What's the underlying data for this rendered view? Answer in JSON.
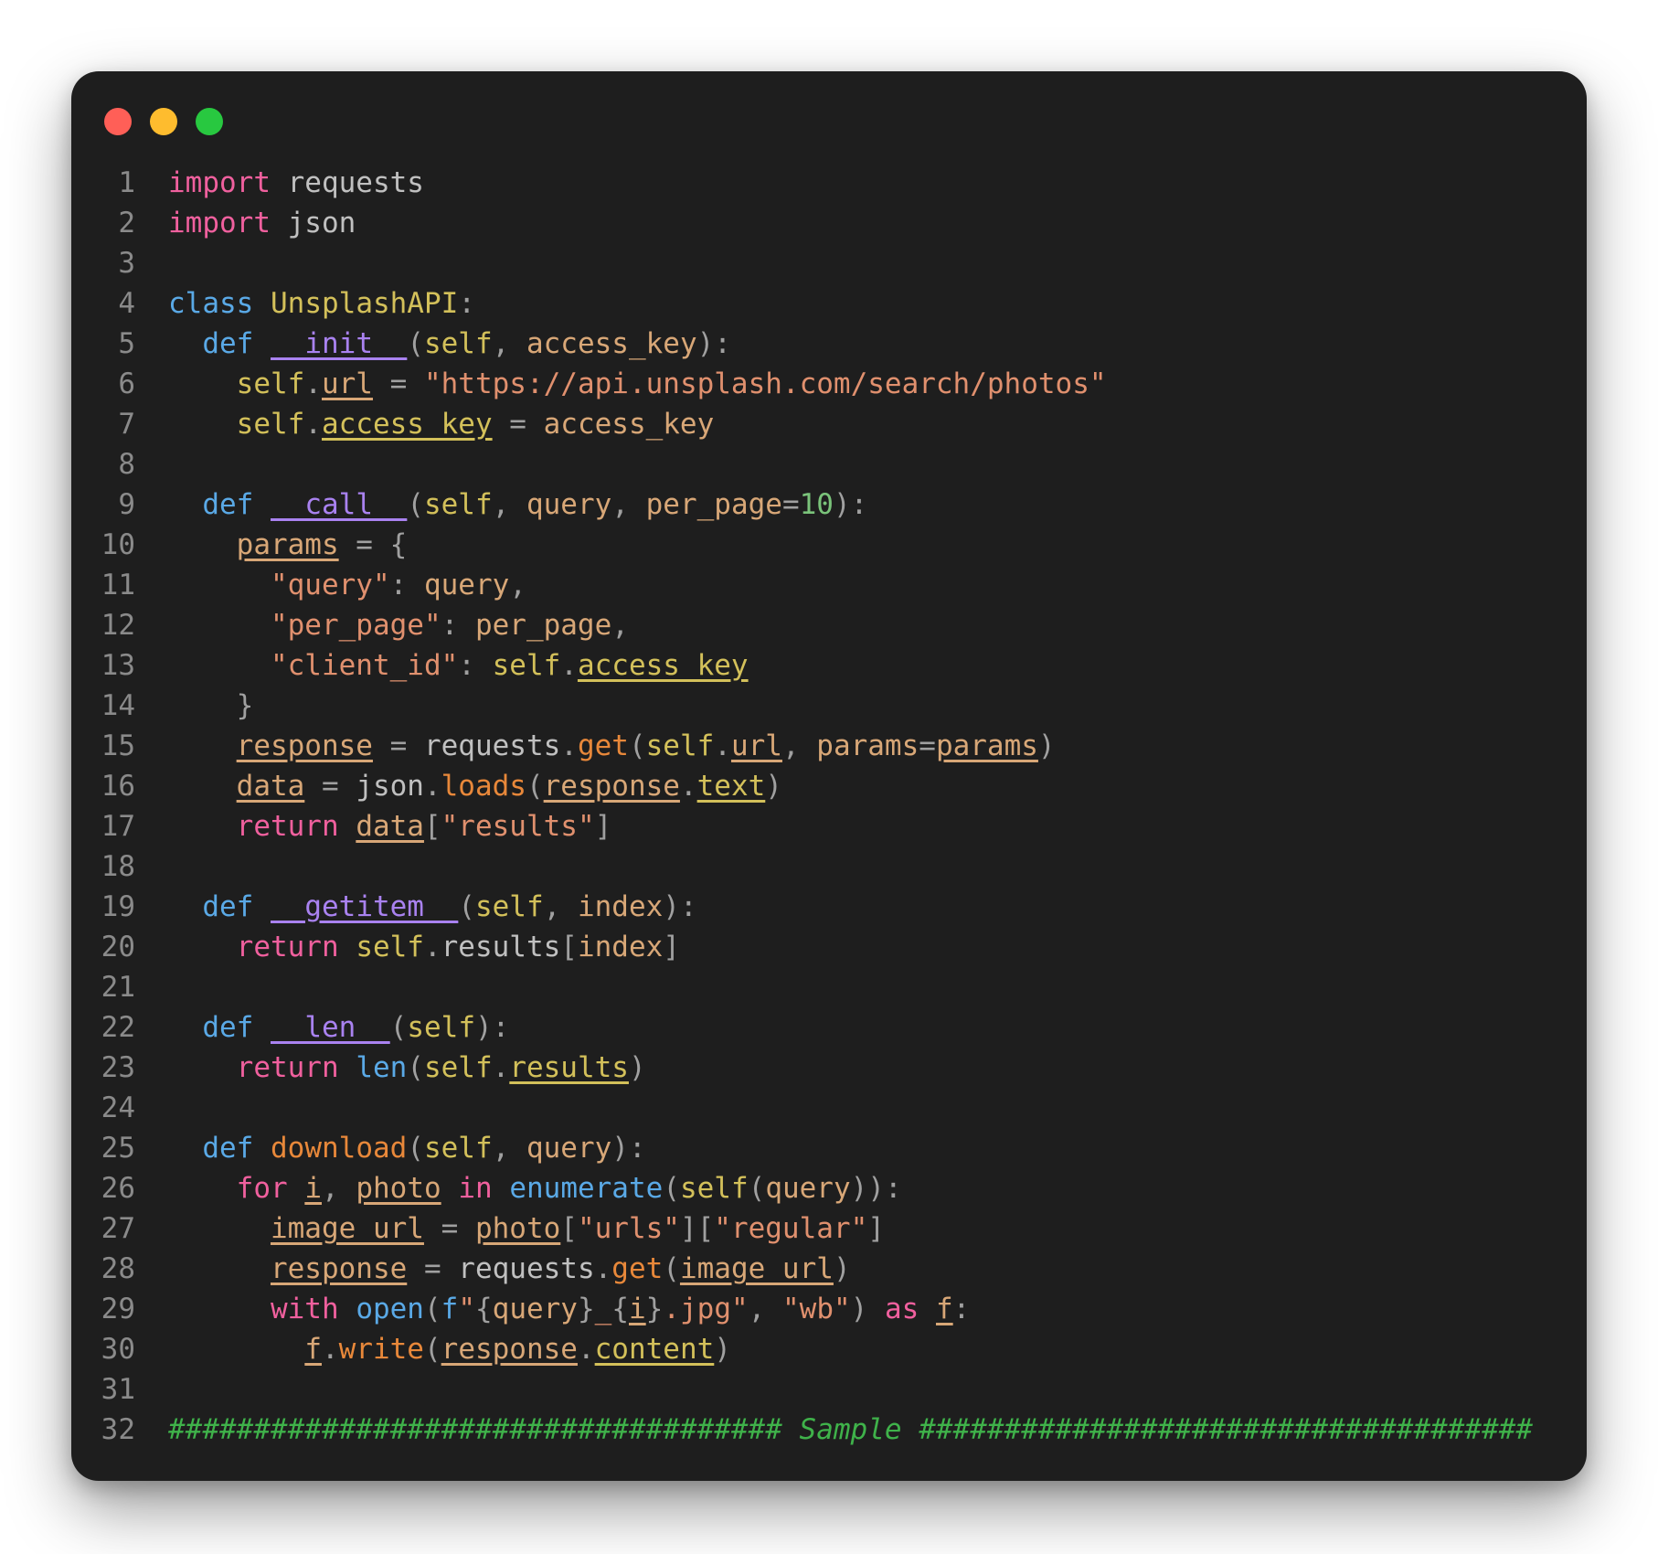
{
  "window": {
    "controls": [
      {
        "name": "close-button",
        "color": "#ff5f57"
      },
      {
        "name": "minimize-button",
        "color": "#febc2e"
      },
      {
        "name": "maximize-button",
        "color": "#28c840"
      }
    ]
  },
  "colors": {
    "keyword_pink": "#f0609e",
    "keyword_blue": "#5aa9e6",
    "class_name": "#d3c05a",
    "dunder": "#a982f0",
    "self": "#d3c05a",
    "string": "#e0906e",
    "number": "#7ac37a",
    "method": "#e8883a",
    "variable": "#d8a777",
    "plain": "#c0c0c0",
    "punct": "#a0a0a0",
    "comment": "#3fb24a"
  },
  "code_lines": [
    [
      {
        "t": "import",
        "c": "keyword_pink"
      },
      {
        "t": " requests",
        "c": "plain"
      }
    ],
    [
      {
        "t": "import",
        "c": "keyword_pink"
      },
      {
        "t": " json",
        "c": "plain"
      }
    ],
    [],
    [
      {
        "t": "class",
        "c": "keyword_blue"
      },
      {
        "t": " ",
        "c": "plain"
      },
      {
        "t": "UnsplashAPI",
        "c": "class_name"
      },
      {
        "t": ":",
        "c": "punct"
      }
    ],
    [
      {
        "t": "  ",
        "c": "plain"
      },
      {
        "t": "def",
        "c": "keyword_blue"
      },
      {
        "t": " ",
        "c": "plain"
      },
      {
        "t": "__init__",
        "c": "dunder",
        "u": true
      },
      {
        "t": "(",
        "c": "punct"
      },
      {
        "t": "self",
        "c": "self"
      },
      {
        "t": ", ",
        "c": "punct"
      },
      {
        "t": "access_key",
        "c": "variable"
      },
      {
        "t": "):",
        "c": "punct"
      }
    ],
    [
      {
        "t": "    ",
        "c": "plain"
      },
      {
        "t": "self",
        "c": "self"
      },
      {
        "t": ".",
        "c": "punct"
      },
      {
        "t": "url",
        "c": "variable",
        "u": true
      },
      {
        "t": " = ",
        "c": "punct"
      },
      {
        "t": "\"https://api.unsplash.com/search/photos\"",
        "c": "string"
      }
    ],
    [
      {
        "t": "    ",
        "c": "plain"
      },
      {
        "t": "self",
        "c": "self"
      },
      {
        "t": ".",
        "c": "punct"
      },
      {
        "t": "access_key",
        "c": "self",
        "u": true
      },
      {
        "t": " = ",
        "c": "punct"
      },
      {
        "t": "access_key",
        "c": "variable"
      }
    ],
    [],
    [
      {
        "t": "  ",
        "c": "plain"
      },
      {
        "t": "def",
        "c": "keyword_blue"
      },
      {
        "t": " ",
        "c": "plain"
      },
      {
        "t": "__call__",
        "c": "dunder",
        "u": true
      },
      {
        "t": "(",
        "c": "punct"
      },
      {
        "t": "self",
        "c": "self"
      },
      {
        "t": ", ",
        "c": "punct"
      },
      {
        "t": "query",
        "c": "variable"
      },
      {
        "t": ", ",
        "c": "punct"
      },
      {
        "t": "per_page",
        "c": "variable"
      },
      {
        "t": "=",
        "c": "punct"
      },
      {
        "t": "10",
        "c": "number"
      },
      {
        "t": "):",
        "c": "punct"
      }
    ],
    [
      {
        "t": "    ",
        "c": "plain"
      },
      {
        "t": "params",
        "c": "variable",
        "u": true
      },
      {
        "t": " = {",
        "c": "punct"
      }
    ],
    [
      {
        "t": "      ",
        "c": "plain"
      },
      {
        "t": "\"query\"",
        "c": "string"
      },
      {
        "t": ": ",
        "c": "punct"
      },
      {
        "t": "query",
        "c": "variable"
      },
      {
        "t": ",",
        "c": "punct"
      }
    ],
    [
      {
        "t": "      ",
        "c": "plain"
      },
      {
        "t": "\"per_page\"",
        "c": "string"
      },
      {
        "t": ": ",
        "c": "punct"
      },
      {
        "t": "per_page",
        "c": "variable"
      },
      {
        "t": ",",
        "c": "punct"
      }
    ],
    [
      {
        "t": "      ",
        "c": "plain"
      },
      {
        "t": "\"client_id\"",
        "c": "string"
      },
      {
        "t": ": ",
        "c": "punct"
      },
      {
        "t": "self",
        "c": "self"
      },
      {
        "t": ".",
        "c": "punct"
      },
      {
        "t": "access_key",
        "c": "self",
        "u": true
      }
    ],
    [
      {
        "t": "    }",
        "c": "punct"
      }
    ],
    [
      {
        "t": "    ",
        "c": "plain"
      },
      {
        "t": "response",
        "c": "variable",
        "u": true
      },
      {
        "t": " = ",
        "c": "punct"
      },
      {
        "t": "requests",
        "c": "plain"
      },
      {
        "t": ".",
        "c": "punct"
      },
      {
        "t": "get",
        "c": "method"
      },
      {
        "t": "(",
        "c": "punct"
      },
      {
        "t": "self",
        "c": "self"
      },
      {
        "t": ".",
        "c": "punct"
      },
      {
        "t": "url",
        "c": "variable",
        "u": true
      },
      {
        "t": ", ",
        "c": "punct"
      },
      {
        "t": "params",
        "c": "variable"
      },
      {
        "t": "=",
        "c": "punct"
      },
      {
        "t": "params",
        "c": "variable",
        "u": true
      },
      {
        "t": ")",
        "c": "punct"
      }
    ],
    [
      {
        "t": "    ",
        "c": "plain"
      },
      {
        "t": "data",
        "c": "variable",
        "u": true
      },
      {
        "t": " = ",
        "c": "punct"
      },
      {
        "t": "json",
        "c": "plain"
      },
      {
        "t": ".",
        "c": "punct"
      },
      {
        "t": "loads",
        "c": "method"
      },
      {
        "t": "(",
        "c": "punct"
      },
      {
        "t": "response",
        "c": "variable",
        "u": true
      },
      {
        "t": ".",
        "c": "punct"
      },
      {
        "t": "text",
        "c": "self",
        "u": true
      },
      {
        "t": ")",
        "c": "punct"
      }
    ],
    [
      {
        "t": "    ",
        "c": "plain"
      },
      {
        "t": "return",
        "c": "keyword_pink"
      },
      {
        "t": " ",
        "c": "plain"
      },
      {
        "t": "data",
        "c": "variable",
        "u": true
      },
      {
        "t": "[",
        "c": "punct"
      },
      {
        "t": "\"results\"",
        "c": "string"
      },
      {
        "t": "]",
        "c": "punct"
      }
    ],
    [],
    [
      {
        "t": "  ",
        "c": "plain"
      },
      {
        "t": "def",
        "c": "keyword_blue"
      },
      {
        "t": " ",
        "c": "plain"
      },
      {
        "t": "__getitem__",
        "c": "dunder",
        "u": true
      },
      {
        "t": "(",
        "c": "punct"
      },
      {
        "t": "self",
        "c": "self"
      },
      {
        "t": ", ",
        "c": "punct"
      },
      {
        "t": "index",
        "c": "variable"
      },
      {
        "t": "):",
        "c": "punct"
      }
    ],
    [
      {
        "t": "    ",
        "c": "plain"
      },
      {
        "t": "return",
        "c": "keyword_pink"
      },
      {
        "t": " ",
        "c": "plain"
      },
      {
        "t": "self",
        "c": "self"
      },
      {
        "t": ".",
        "c": "punct"
      },
      {
        "t": "results",
        "c": "plain"
      },
      {
        "t": "[",
        "c": "punct"
      },
      {
        "t": "index",
        "c": "variable"
      },
      {
        "t": "]",
        "c": "punct"
      }
    ],
    [],
    [
      {
        "t": "  ",
        "c": "plain"
      },
      {
        "t": "def",
        "c": "keyword_blue"
      },
      {
        "t": " ",
        "c": "plain"
      },
      {
        "t": "__len__",
        "c": "dunder",
        "u": true
      },
      {
        "t": "(",
        "c": "punct"
      },
      {
        "t": "self",
        "c": "self"
      },
      {
        "t": "):",
        "c": "punct"
      }
    ],
    [
      {
        "t": "    ",
        "c": "plain"
      },
      {
        "t": "return",
        "c": "keyword_pink"
      },
      {
        "t": " ",
        "c": "plain"
      },
      {
        "t": "len",
        "c": "keyword_blue"
      },
      {
        "t": "(",
        "c": "punct"
      },
      {
        "t": "self",
        "c": "self"
      },
      {
        "t": ".",
        "c": "punct"
      },
      {
        "t": "results",
        "c": "self",
        "u": true
      },
      {
        "t": ")",
        "c": "punct"
      }
    ],
    [],
    [
      {
        "t": "  ",
        "c": "plain"
      },
      {
        "t": "def",
        "c": "keyword_blue"
      },
      {
        "t": " ",
        "c": "plain"
      },
      {
        "t": "download",
        "c": "method"
      },
      {
        "t": "(",
        "c": "punct"
      },
      {
        "t": "self",
        "c": "self"
      },
      {
        "t": ", ",
        "c": "punct"
      },
      {
        "t": "query",
        "c": "variable"
      },
      {
        "t": "):",
        "c": "punct"
      }
    ],
    [
      {
        "t": "    ",
        "c": "plain"
      },
      {
        "t": "for",
        "c": "keyword_pink"
      },
      {
        "t": " ",
        "c": "plain"
      },
      {
        "t": "i",
        "c": "variable",
        "u": true
      },
      {
        "t": ", ",
        "c": "punct"
      },
      {
        "t": "photo",
        "c": "variable",
        "u": true
      },
      {
        "t": " ",
        "c": "plain"
      },
      {
        "t": "in",
        "c": "keyword_pink"
      },
      {
        "t": " ",
        "c": "plain"
      },
      {
        "t": "enumerate",
        "c": "keyword_blue"
      },
      {
        "t": "(",
        "c": "punct"
      },
      {
        "t": "self",
        "c": "self"
      },
      {
        "t": "(",
        "c": "punct"
      },
      {
        "t": "query",
        "c": "variable"
      },
      {
        "t": ")):",
        "c": "punct"
      }
    ],
    [
      {
        "t": "      ",
        "c": "plain"
      },
      {
        "t": "image_url",
        "c": "variable",
        "u": true
      },
      {
        "t": " = ",
        "c": "punct"
      },
      {
        "t": "photo",
        "c": "variable",
        "u": true
      },
      {
        "t": "[",
        "c": "punct"
      },
      {
        "t": "\"urls\"",
        "c": "string"
      },
      {
        "t": "][",
        "c": "punct"
      },
      {
        "t": "\"regular\"",
        "c": "string"
      },
      {
        "t": "]",
        "c": "punct"
      }
    ],
    [
      {
        "t": "      ",
        "c": "plain"
      },
      {
        "t": "response",
        "c": "variable",
        "u": true
      },
      {
        "t": " = ",
        "c": "punct"
      },
      {
        "t": "requests",
        "c": "plain"
      },
      {
        "t": ".",
        "c": "punct"
      },
      {
        "t": "get",
        "c": "method"
      },
      {
        "t": "(",
        "c": "punct"
      },
      {
        "t": "image_url",
        "c": "variable",
        "u": true
      },
      {
        "t": ")",
        "c": "punct"
      }
    ],
    [
      {
        "t": "      ",
        "c": "plain"
      },
      {
        "t": "with",
        "c": "keyword_pink"
      },
      {
        "t": " ",
        "c": "plain"
      },
      {
        "t": "open",
        "c": "keyword_blue"
      },
      {
        "t": "(",
        "c": "punct"
      },
      {
        "t": "f",
        "c": "keyword_blue"
      },
      {
        "t": "\"",
        "c": "string"
      },
      {
        "t": "{",
        "c": "punct"
      },
      {
        "t": "query",
        "c": "variable"
      },
      {
        "t": "}",
        "c": "punct"
      },
      {
        "t": "_",
        "c": "string"
      },
      {
        "t": "{",
        "c": "punct"
      },
      {
        "t": "i",
        "c": "variable",
        "u": true
      },
      {
        "t": "}",
        "c": "punct"
      },
      {
        "t": ".jpg\"",
        "c": "string"
      },
      {
        "t": ", ",
        "c": "punct"
      },
      {
        "t": "\"wb\"",
        "c": "string"
      },
      {
        "t": ") ",
        "c": "punct"
      },
      {
        "t": "as",
        "c": "keyword_pink"
      },
      {
        "t": " ",
        "c": "plain"
      },
      {
        "t": "f",
        "c": "variable",
        "u": true
      },
      {
        "t": ":",
        "c": "punct"
      }
    ],
    [
      {
        "t": "        ",
        "c": "plain"
      },
      {
        "t": "f",
        "c": "variable",
        "u": true
      },
      {
        "t": ".",
        "c": "punct"
      },
      {
        "t": "write",
        "c": "method"
      },
      {
        "t": "(",
        "c": "punct"
      },
      {
        "t": "response",
        "c": "variable",
        "u": true
      },
      {
        "t": ".",
        "c": "punct"
      },
      {
        "t": "content",
        "c": "self",
        "u": true
      },
      {
        "t": ")",
        "c": "punct"
      }
    ],
    [],
    [
      {
        "t": "#################################### Sample ####################################",
        "c": "comment",
        "i": true
      }
    ]
  ]
}
